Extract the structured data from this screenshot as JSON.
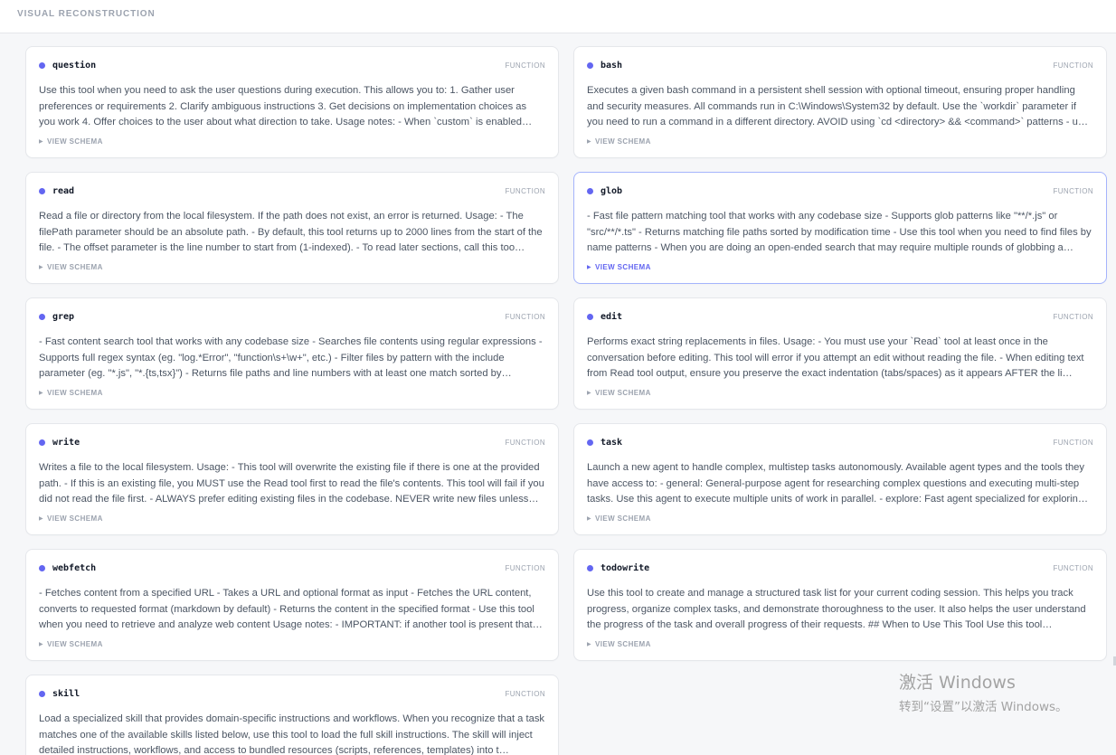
{
  "header": {
    "title": "VISUAL RECONSTRUCTION"
  },
  "common": {
    "kind_label": "FUNCTION",
    "schema_label": "VIEW SCHEMA"
  },
  "tools": [
    {
      "name": "question",
      "description": "Use this tool when you need to ask the user questions during execution. This allows you to: 1. Gather user preferences or requirements 2. Clarify ambiguous instructions 3. Get decisions on implementation choices as you work 4. Offer choices to the user about what direction to take. Usage notes: - When `custom` is enabled…"
    },
    {
      "name": "bash",
      "description": "Executes a given bash command in a persistent shell session with optional timeout, ensuring proper handling and security measures. All commands run in C:\\Windows\\System32 by default. Use the `workdir` parameter if you need to run a command in a different directory. AVOID using `cd <directory> && <command>` patterns - u…"
    },
    {
      "name": "read",
      "description": "Read a file or directory from the local filesystem. If the path does not exist, an error is returned. Usage: - The filePath parameter should be an absolute path. - By default, this tool returns up to 2000 lines from the start of the file. - The offset parameter is the line number to start from (1-indexed). - To read later sections, call this too…"
    },
    {
      "name": "glob",
      "description": "- Fast file pattern matching tool that works with any codebase size - Supports glob patterns like \"**/*.js\" or \"src/**/*.ts\" - Returns matching file paths sorted by modification time - Use this tool when you need to find files by name patterns - When you are doing an open-ended search that may require multiple rounds of globbing a…"
    },
    {
      "name": "grep",
      "description": "- Fast content search tool that works with any codebase size - Searches file contents using regular expressions - Supports full regex syntax (eg. \"log.*Error\", \"function\\s+\\w+\", etc.) - Filter files by pattern with the include parameter (eg. \"*.js\", \"*.{ts,tsx}\") - Returns file paths and line numbers with at least one match sorted by…"
    },
    {
      "name": "edit",
      "description": "Performs exact string replacements in files. Usage: - You must use your `Read` tool at least once in the conversation before editing. This tool will error if you attempt an edit without reading the file. - When editing text from Read tool output, ensure you preserve the exact indentation (tabs/spaces) as it appears AFTER the li…"
    },
    {
      "name": "write",
      "description": "Writes a file to the local filesystem. Usage: - This tool will overwrite the existing file if there is one at the provided path. - If this is an existing file, you MUST use the Read tool first to read the file's contents. This tool will fail if you did not read the file first. - ALWAYS prefer editing existing files in the codebase. NEVER write new files unless…"
    },
    {
      "name": "task",
      "description": "Launch a new agent to handle complex, multistep tasks autonomously. Available agent types and the tools they have access to: - general: General-purpose agent for researching complex questions and executing multi-step tasks. Use this agent to execute multiple units of work in parallel. - explore: Fast agent specialized for explorin…"
    },
    {
      "name": "webfetch",
      "description": "- Fetches content from a specified URL - Takes a URL and optional format as input - Fetches the URL content, converts to requested format (markdown by default) - Returns the content in the specified format - Use this tool when you need to retrieve and analyze web content Usage notes: - IMPORTANT: if another tool is present that…"
    },
    {
      "name": "todowrite",
      "description": "Use this tool to create and manage a structured task list for your current coding session. This helps you track progress, organize complex tasks, and demonstrate thoroughness to the user. It also helps the user understand the progress of the task and overall progress of their requests. ## When to Use This Tool Use this tool proactive…"
    },
    {
      "name": "skill",
      "description": "Load a specialized skill that provides domain-specific instructions and workflows. When you recognize that a task matches one of the available skills listed below, use this tool to load the full skill instructions. The skill will inject detailed instructions, workflows, and access to bundled resources (scripts, references, templates) into t…"
    }
  ],
  "watermark": {
    "title": "激活 Windows",
    "subtitle": "转到“设置”以激活 Windows。"
  },
  "colors": {
    "accent": "#6366f1",
    "active_border": "#a5b4fc",
    "muted": "#9ca3af"
  }
}
